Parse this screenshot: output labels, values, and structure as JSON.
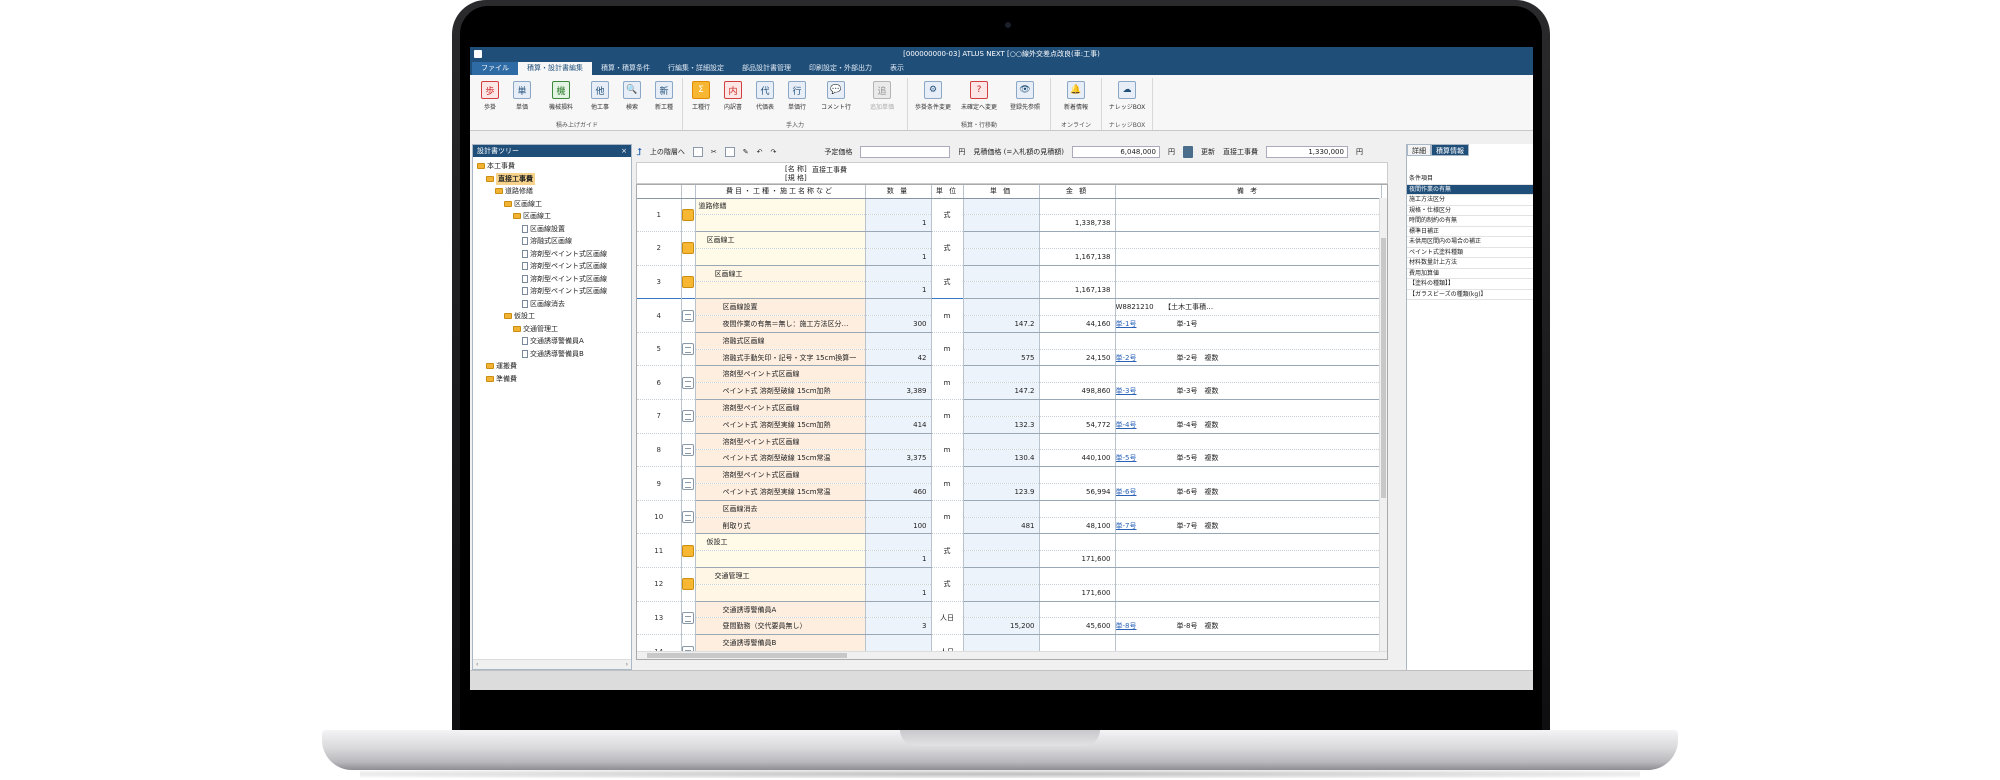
{
  "window": {
    "title": "[000000000-03] ATLUS NEXT [○○線外交差点改良(車:工事)"
  },
  "menu": {
    "tabs": [
      "ファイル",
      "積算・設計書編集",
      "積算・積算条件",
      "行編集・詳細設定",
      "部品設計書管理",
      "印刷設定・外部出力",
      "表示"
    ]
  },
  "ribbon": {
    "groups": [
      {
        "name": "積み上げガイド",
        "buttons": [
          {
            "label": "歩掛",
            "icon": "step-icon"
          },
          {
            "label": "単価",
            "icon": "unit-price-icon"
          },
          {
            "label": "機械損料",
            "icon": "machine-icon"
          },
          {
            "label": "他工事",
            "icon": "other-work-icon"
          },
          {
            "label": "検索",
            "icon": "search-icon"
          },
          {
            "label": "新工種",
            "icon": "new-work-icon"
          }
        ]
      },
      {
        "name": "手入力",
        "buttons": [
          {
            "label": "工種行",
            "icon": "sum-icon"
          },
          {
            "label": "内訳書",
            "icon": "breakdown-icon"
          },
          {
            "label": "代価表",
            "icon": "price-table-icon"
          },
          {
            "label": "単価行",
            "icon": "unit-row-icon"
          },
          {
            "label": "コメント行",
            "icon": "comment-icon"
          },
          {
            "label": "追加単価",
            "icon": "additional-price-icon"
          }
        ]
      },
      {
        "name": "積算・行移動",
        "buttons": [
          {
            "label": "歩掛条件変更",
            "icon": "condition-change-icon"
          },
          {
            "label": "未確定へ変更",
            "icon": "unconfirmed-icon"
          },
          {
            "label": "登録先参照",
            "icon": "reference-icon"
          }
        ]
      },
      {
        "name": "オンライン",
        "buttons": [
          {
            "label": "新着情報",
            "icon": "bell-icon"
          }
        ]
      },
      {
        "name": "ナレッジBOX",
        "buttons": [
          {
            "label": "ナレッジBOX",
            "icon": "knowledge-icon"
          }
        ]
      }
    ]
  },
  "tree": {
    "title": "設計書ツリー",
    "nodes": [
      {
        "label": "本工事費",
        "type": "folder",
        "level": 0
      },
      {
        "label": "直接工事費",
        "type": "folder",
        "level": 1,
        "selected": true
      },
      {
        "label": "道路修繕",
        "type": "folder",
        "level": 2
      },
      {
        "label": "区画線工",
        "type": "folder",
        "level": 3
      },
      {
        "label": "区画線工",
        "type": "folder",
        "level": 4
      },
      {
        "label": "区画線設置",
        "type": "doc",
        "level": 5
      },
      {
        "label": "溶融式区画線",
        "type": "doc",
        "level": 5
      },
      {
        "label": "溶剤型ペイント式区画線",
        "type": "doc",
        "level": 5
      },
      {
        "label": "溶剤型ペイント式区画線",
        "type": "doc",
        "level": 5
      },
      {
        "label": "溶剤型ペイント式区画線",
        "type": "doc",
        "level": 5
      },
      {
        "label": "溶剤型ペイント式区画線",
        "type": "doc",
        "level": 5
      },
      {
        "label": "区画線消去",
        "type": "doc",
        "level": 5
      },
      {
        "label": "仮設工",
        "type": "folder",
        "level": 3
      },
      {
        "label": "交通管理工",
        "type": "folder",
        "level": 4
      },
      {
        "label": "交通誘導警備員A",
        "type": "doc",
        "level": 5
      },
      {
        "label": "交通誘導警備員B",
        "type": "doc",
        "level": 5
      },
      {
        "label": "運搬費",
        "type": "folder",
        "level": 1
      },
      {
        "label": "準備費",
        "type": "folder",
        "level": 1
      }
    ]
  },
  "toolbar": {
    "up_label": "上の階層へ",
    "planned_price_label": "予定価格",
    "planned_price_value": "",
    "planned_price_unit": "円",
    "estimate_label": "見積価格 (=入札額の見積額)",
    "estimate_value": "6,048,000",
    "estimate_unit": "円",
    "update_label": "更新",
    "direct_cost_label": "直接工事費",
    "direct_cost_value": "1,330,000",
    "direct_cost_unit": "円"
  },
  "name_box": {
    "label_name": "[名 称]",
    "label_spec": "[規 格]",
    "value": "直接工事費"
  },
  "grid": {
    "headers": [
      "",
      "",
      "費目・工種・施工名称など",
      "数 量",
      "単 位",
      "単 価",
      "金 額",
      "備 考"
    ],
    "rows": [
      {
        "no": "1",
        "icon": "folder",
        "indent": 0,
        "name1": "道路修繕",
        "name2": "",
        "qty": "1",
        "unit": "式",
        "price": "",
        "amount": "1,338,738",
        "note1": "",
        "note1_link": false,
        "note2": ""
      },
      {
        "no": "2",
        "icon": "folder",
        "indent": 1,
        "name1": "区画線工",
        "name2": "",
        "qty": "1",
        "unit": "式",
        "price": "",
        "amount": "1,167,138",
        "note1": "",
        "note1_link": false,
        "note2": ""
      },
      {
        "no": "3",
        "icon": "folder",
        "indent": 2,
        "name1": "区画線工",
        "name2": "",
        "qty": "1",
        "unit": "式",
        "price": "",
        "amount": "1,167,138",
        "note1": "",
        "note1_link": false,
        "note2": ""
      },
      {
        "no": "4",
        "icon": "doc",
        "indent": 3,
        "name1": "区画線設置",
        "name2": "夜間作業の有無＝無し：施工方法区分…",
        "qty": "300",
        "unit": "m",
        "price": "147.2",
        "amount": "44,160",
        "note1": "単-1号",
        "note1_link": true,
        "note2": "単-1号",
        "note_top": "W8821210　　【土木工事積…"
      },
      {
        "no": "5",
        "icon": "doc",
        "indent": 3,
        "name1": "溶融式区画線",
        "name2": "溶融式手動矢印・記号・文字 15cm換算一",
        "qty": "42",
        "unit": "m",
        "price": "575",
        "amount": "24,150",
        "note1": "単-2号",
        "note1_link": true,
        "note2": "単-2号　複数"
      },
      {
        "no": "6",
        "icon": "doc",
        "indent": 3,
        "name1": "溶剤型ペイント式区画線",
        "name2": "ペイント式 溶剤型破線 15cm加熱",
        "qty": "3,389",
        "unit": "m",
        "price": "147.2",
        "amount": "498,860",
        "note1": "単-3号",
        "note1_link": true,
        "note2": "単-3号　複数"
      },
      {
        "no": "7",
        "icon": "doc",
        "indent": 3,
        "name1": "溶剤型ペイント式区画線",
        "name2": "ペイント式 溶剤型実線 15cm加熱",
        "qty": "414",
        "unit": "m",
        "price": "132.3",
        "amount": "54,772",
        "note1": "単-4号",
        "note1_link": true,
        "note2": "単-4号　複数"
      },
      {
        "no": "8",
        "icon": "doc",
        "indent": 3,
        "name1": "溶剤型ペイント式区画線",
        "name2": "ペイント式 溶剤型破線 15cm常温",
        "qty": "3,375",
        "unit": "m",
        "price": "130.4",
        "amount": "440,100",
        "note1": "単-5号",
        "note1_link": true,
        "note2": "単-5号　複数"
      },
      {
        "no": "9",
        "icon": "doc",
        "indent": 3,
        "name1": "溶剤型ペイント式区画線",
        "name2": "ペイント式 溶剤型実線 15cm常温",
        "qty": "460",
        "unit": "m",
        "price": "123.9",
        "amount": "56,994",
        "note1": "単-6号",
        "note1_link": true,
        "note2": "単-6号　複数"
      },
      {
        "no": "10",
        "icon": "doc",
        "indent": 3,
        "name1": "区画線消去",
        "name2": "削取り式",
        "qty": "100",
        "unit": "m",
        "price": "481",
        "amount": "48,100",
        "note1": "単-7号",
        "note1_link": true,
        "note2": "単-7号　複数"
      },
      {
        "no": "11",
        "icon": "folder",
        "indent": 1,
        "name1": "仮設工",
        "name2": "",
        "qty": "1",
        "unit": "式",
        "price": "",
        "amount": "171,600",
        "note1": "",
        "note1_link": false,
        "note2": ""
      },
      {
        "no": "12",
        "icon": "folder",
        "indent": 2,
        "name1": "交通管理工",
        "name2": "",
        "qty": "1",
        "unit": "式",
        "price": "",
        "amount": "171,600",
        "note1": "",
        "note1_link": false,
        "note2": ""
      },
      {
        "no": "13",
        "icon": "doc",
        "indent": 3,
        "name1": "交通誘導警備員A",
        "name2": "昼間勤務（交代要員無し）",
        "qty": "3",
        "unit": "人日",
        "price": "15,200",
        "amount": "45,600",
        "note1": "単-8号",
        "note1_link": true,
        "note2": "単-8号　複数"
      },
      {
        "no": "14",
        "icon": "doc",
        "indent": 3,
        "name1": "交通誘導警備員B",
        "name2": "",
        "qty": "",
        "unit": "人日",
        "price": "",
        "amount": "",
        "note1": "",
        "note1_link": false,
        "note2": ""
      }
    ]
  },
  "right_panel": {
    "tabs": [
      "詳細",
      "積算情報"
    ],
    "items": [
      "条件項目",
      "夜間作業の有無",
      "施工方法区分",
      "規格・仕様区分",
      "時間的制約の有無",
      "標準日補正",
      "未供用区間内の場合の補正",
      "ペイント式塗料種類",
      "材料数量計上方法",
      "費用加算値",
      "【塗料の種類】】",
      "【ガラスビーズの種類(kg)】"
    ],
    "selected_index": 1
  }
}
